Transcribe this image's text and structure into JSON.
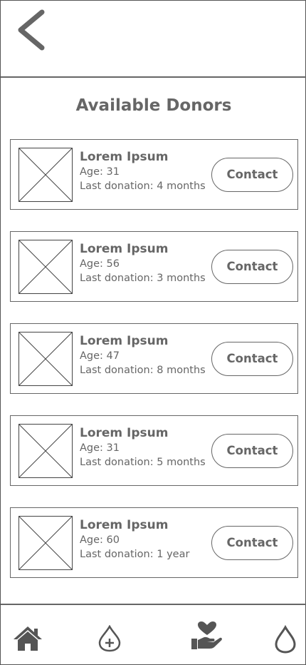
{
  "header": {
    "back_icon": "chevron-left-icon"
  },
  "page": {
    "title": "Available Donors"
  },
  "donors": [
    {
      "name": "Lorem Ipsum",
      "age": "Age: 31",
      "last_donation": "Last donation: 4 months",
      "action": "Contact"
    },
    {
      "name": "Lorem Ipsum",
      "age": "Age: 56",
      "last_donation": "Last donation: 3 months",
      "action": "Contact"
    },
    {
      "name": "Lorem Ipsum",
      "age": "Age: 47",
      "last_donation": "Last donation: 8 months",
      "action": "Contact"
    },
    {
      "name": "Lorem Ipsum",
      "age": "Age: 31",
      "last_donation": "Last donation: 5 months",
      "action": "Contact"
    },
    {
      "name": "Lorem Ipsum",
      "age": "Age: 60",
      "last_donation": "Last donation: 1 year",
      "action": "Contact"
    }
  ],
  "bottom_nav": {
    "items": [
      {
        "icon": "home-icon"
      },
      {
        "icon": "add-donation-drop-icon"
      },
      {
        "icon": "heart-in-hand-icon"
      },
      {
        "icon": "blood-drop-icon"
      }
    ]
  },
  "colors": {
    "stroke": "#666666",
    "background": "#ffffff"
  }
}
